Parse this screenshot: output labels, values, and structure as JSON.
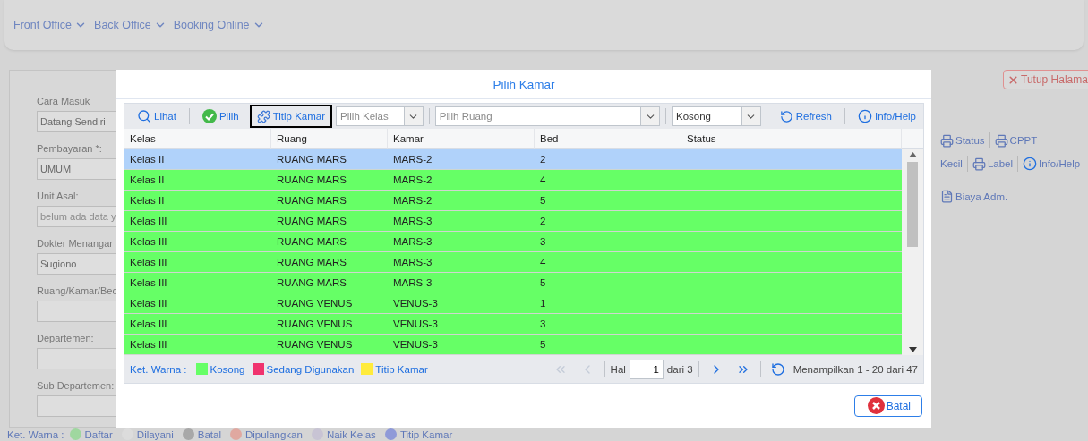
{
  "nav": {
    "menus": [
      "Front Office",
      "Back Office",
      "Booking Online"
    ]
  },
  "form": {
    "fields": [
      {
        "label": "Cara Masuk",
        "value": "Datang Sendiri"
      },
      {
        "label": "Pembayaran *:",
        "value": "UMUM"
      },
      {
        "label": "Unit Asal:",
        "placeholder": "belum ada data y"
      },
      {
        "label": "Dokter Menangar",
        "value": "Sugiono"
      },
      {
        "label": "Ruang/Kamar/Bec"
      },
      {
        "label": "Departemen:"
      },
      {
        "label": "Sub Departemen:"
      }
    ]
  },
  "right_panel": {
    "close_button": "Tutup Halama",
    "toolbar_1": [
      "Status",
      "CPPT"
    ],
    "toolbar_2": [
      {
        "label": "Kecil",
        "kind": "text"
      },
      {
        "label": "Label",
        "kind": "printer"
      },
      {
        "label": "Info/Help",
        "kind": "info"
      }
    ],
    "tab": "Biaya Adm."
  },
  "bottom_legend": {
    "title": "Ket. Warna :",
    "items": [
      {
        "label": "Daftar",
        "color": "#9fd79f"
      },
      {
        "label": "Dilayani",
        "color": "#dcdcdc"
      },
      {
        "label": "Batal",
        "color": "#a8a8a8"
      },
      {
        "label": "Dipulangkan",
        "color": "#e0a8a0"
      },
      {
        "label": "Naik Kelas",
        "color": "#c8c4d4"
      },
      {
        "label": "Titip Kamar",
        "color": "#8f9ad8"
      }
    ]
  },
  "dialog": {
    "title": "Pilih Kamar",
    "toolbar": {
      "buttons": [
        {
          "label": "Lihat",
          "kind": "search",
          "focused": false
        },
        {
          "label": "Pilih",
          "kind": "check",
          "focused": false
        },
        {
          "label": "Titip Kamar",
          "kind": "puzzle",
          "focused": true
        }
      ],
      "selects": [
        {
          "placeholder": "Pilih Kelas"
        },
        {
          "placeholder": "Pilih Ruang"
        },
        {
          "value": "Kosong"
        }
      ],
      "actions": [
        {
          "label": "Refresh",
          "kind": "refresh"
        },
        {
          "label": "Info/Help",
          "kind": "info"
        }
      ]
    },
    "table": {
      "columns": [
        "Kelas",
        "Ruang",
        "Kamar",
        "Bed",
        "Status"
      ],
      "rows": [
        {
          "cells": [
            "Kelas II",
            "RUANG MARS",
            "MARS-2",
            "2"
          ],
          "selected": true
        },
        {
          "cells": [
            "Kelas II",
            "RUANG MARS",
            "MARS-2",
            "4"
          ],
          "selected": false
        },
        {
          "cells": [
            "Kelas II",
            "RUANG MARS",
            "MARS-2",
            "5"
          ],
          "selected": false
        },
        {
          "cells": [
            "Kelas III",
            "RUANG MARS",
            "MARS-3",
            "2"
          ],
          "selected": false
        },
        {
          "cells": [
            "Kelas III",
            "RUANG MARS",
            "MARS-3",
            "3"
          ],
          "selected": false
        },
        {
          "cells": [
            "Kelas III",
            "RUANG MARS",
            "MARS-3",
            "4"
          ],
          "selected": false
        },
        {
          "cells": [
            "Kelas III",
            "RUANG MARS",
            "MARS-3",
            "5"
          ],
          "selected": false
        },
        {
          "cells": [
            "Kelas III",
            "RUANG VENUS",
            "VENUS-3",
            "1"
          ],
          "selected": false
        },
        {
          "cells": [
            "Kelas III",
            "RUANG VENUS",
            "VENUS-3",
            "3"
          ],
          "selected": false
        },
        {
          "cells": [
            "Kelas III",
            "RUANG VENUS",
            "VENUS-3",
            "5"
          ],
          "selected": false
        }
      ]
    },
    "legend": {
      "title": "Ket. Warna :",
      "items": [
        {
          "label": "Kosong",
          "color": "#66ff66"
        },
        {
          "label": "Sedang Digunakan",
          "color": "#f0336e"
        },
        {
          "label": "Titip Kamar",
          "color": "#ffeb3b"
        }
      ]
    },
    "pager": {
      "page_label": "Hal",
      "page": "1",
      "of": "dari 3",
      "summary": "Menampilkan 1 - 20 dari 47",
      "first_disabled": true,
      "prev_disabled": true,
      "next_disabled": false,
      "last_disabled": false
    },
    "cancel_button": "Batal"
  }
}
